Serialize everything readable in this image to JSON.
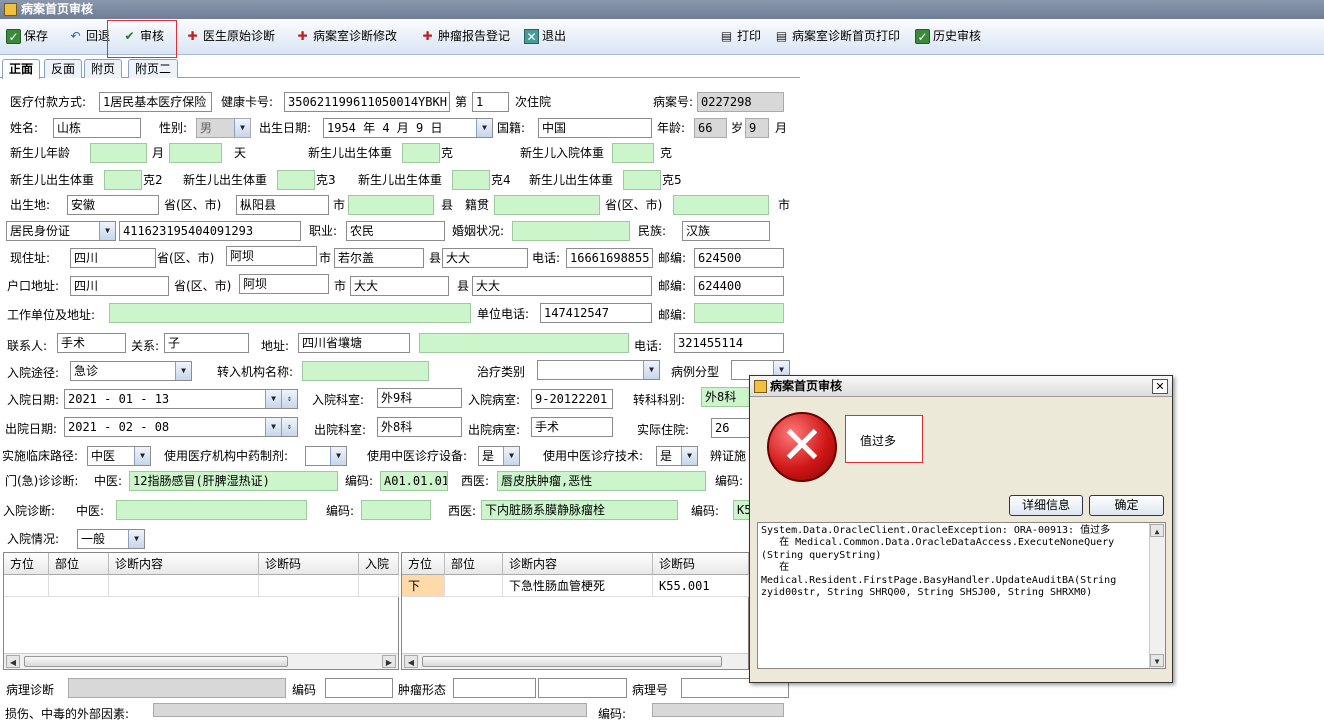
{
  "window": {
    "title": "病案首页审核"
  },
  "toolbar": {
    "save": "保存",
    "back": "回退",
    "audit": "审核",
    "doctor_diag": "医生原始诊断",
    "room_modify": "病案室诊断修改",
    "tumor": "肿瘤报告登记",
    "exit": "退出",
    "print": "打印",
    "room_print": "病案室诊断首页打印",
    "history": "历史审核"
  },
  "tabs": [
    "正面",
    "反面",
    "附页",
    "附页二"
  ],
  "form": {
    "pay_label": "医疗付款方式:",
    "pay_value": "1居民基本医疗保险",
    "health_label": "健康卡号:",
    "health_value": "350621199611050014YBKH",
    "nth_label": "第",
    "nth_value": "1",
    "nth_suffix": "次住院",
    "case_label": "病案号:",
    "case_value": "0227298",
    "name_label": "姓名:",
    "name_value": "山栋",
    "sex_label": "性别:",
    "sex_value": "男",
    "birth_label": "出生日期:",
    "birth_value": "1954 年 4 月 9 日",
    "country_label": "国籍:",
    "country_value": "中国",
    "age_label": "年龄:",
    "age_value": "66",
    "age_unit": "岁",
    "month_value": "9",
    "month_unit": "月",
    "nb_age_label": "新生儿年龄",
    "nb_month": "月",
    "nb_day": "天",
    "nb_birth_w": "新生儿出生体重",
    "gram": "克",
    "nb_in_w": "新生儿入院体重",
    "nb_w2": "克2",
    "nb_w3": "克3",
    "nb_w4": "克4",
    "nb_w5": "克5",
    "birthplace_label": "出生地:",
    "birthplace_prov": "安徽",
    "prov_city": "省(区、市)",
    "birthplace_county": "枞阳县",
    "city": "市",
    "county": "县",
    "native_label": "籍贯",
    "id_type": "居民身份证",
    "id_value": "411623195404091293",
    "job_label": "职业:",
    "job_value": "农民",
    "marriage_label": "婚姻状况:",
    "nation_label": "民族:",
    "nation_value": "汉族",
    "addr_label": "现住址:",
    "addr_prov": "四川",
    "addr_city": "阿坝",
    "addr_county": "若尔盖",
    "addr_detail": "大大",
    "phone_label": "电话:",
    "phone_value": "16661698855",
    "zip_label": "邮编:",
    "zip_value": "624500",
    "hukou_label": "户口地址:",
    "hukou_prov": "四川",
    "hukou_city": "阿坝",
    "hukou_county": "大大",
    "hukou_detail": "大大",
    "hukou_zip": "624400",
    "work_label": "工作单位及地址:",
    "work_phone_label": "单位电话:",
    "work_phone": "147412547",
    "contact_label": "联系人:",
    "contact_value": "手术",
    "relation_label": "关系:",
    "relation_value": "子",
    "contact_addr_label": "地址:",
    "contact_addr": "四川省壤塘",
    "contact_phone": "321455114",
    "route_label": "入院途径:",
    "route_value": "急诊",
    "transfer_label": "转入机构名称:",
    "treat_label": "治疗类别",
    "type_label": "病例分型",
    "in_date_label": "入院日期:",
    "in_date": "2021 - 01 - 13",
    "in_dept_label": "入院科室:",
    "in_dept": "外9科",
    "in_room_label": "入院病室:",
    "in_room": "9-20122201",
    "trans_dept_label": "转科科别:",
    "trans_dept": "外8科",
    "out_date_label": "出院日期:",
    "out_date": "2021 - 02 - 08",
    "out_dept_label": "出院科室:",
    "out_dept": "外8科",
    "out_room_label": "出院病室:",
    "out_room": "手术",
    "stay_label": "实际住院:",
    "stay_value": "26",
    "path_label": "实施临床路径:",
    "path_value": "中医",
    "herb_label": "使用医疗机构中药制剂:",
    "equip_label": "使用中医诊疗设备:",
    "equip_value": "是",
    "tech_label": "使用中医诊疗技术:",
    "tech_value": "是",
    "syndrome_label": "辨证施",
    "er_label": "门(急)诊诊断:",
    "tcm_label": "中医:",
    "er_tcm": "12指肠感冒(肝脾湿热证)",
    "code_label": "编码:",
    "er_code": "A01.01.01",
    "wm_label": "西医:",
    "er_wm": "唇皮肤肿瘤,恶性",
    "adm_label": "入院诊断:",
    "adm_wm": "下内脏肠系膜静脉瘤栓",
    "adm_code": "K5",
    "cond_label": "入院情况:",
    "cond_value": "一般",
    "path_diag_label": "病理诊断",
    "code_label2": "编码",
    "tumor_label": "肿瘤形态",
    "path_no_label": "病理号",
    "external_label": "损伤、中毒的外部因素:",
    "code_label3": "编码:"
  },
  "grid_left": {
    "headers": [
      "方位",
      "部位",
      "诊断内容",
      "诊断码",
      "入院病"
    ]
  },
  "grid_right": {
    "headers": [
      "方位",
      "部位",
      "诊断内容",
      "诊断码"
    ],
    "rows": [
      {
        "pos": "下",
        "part": "",
        "content": "下急性肠血管梗死",
        "code": "K55.001"
      }
    ]
  },
  "dialog": {
    "title": "病案首页审核",
    "message": "值过多",
    "details_btn": "详细信息",
    "ok_btn": "确定",
    "detail": "System.Data.OracleClient.OracleException: ORA-00913: 值过多\n   在 Medical.Common.Data.OracleDataAccess.ExecuteNoneQuery\n(String queryString)\n   在 Medical.Resident.FirstPage.BasyHandler.UpdateAuditBA(String\nzyid00str, String SHRQ00, String SHSJ00, String SHRXM0)"
  },
  "icons": {
    "error": "error-x-icon",
    "check": "check-icon",
    "back": "undo-icon",
    "print": "printer-icon",
    "exit": "exit-icon",
    "report": "document-red-icon"
  }
}
